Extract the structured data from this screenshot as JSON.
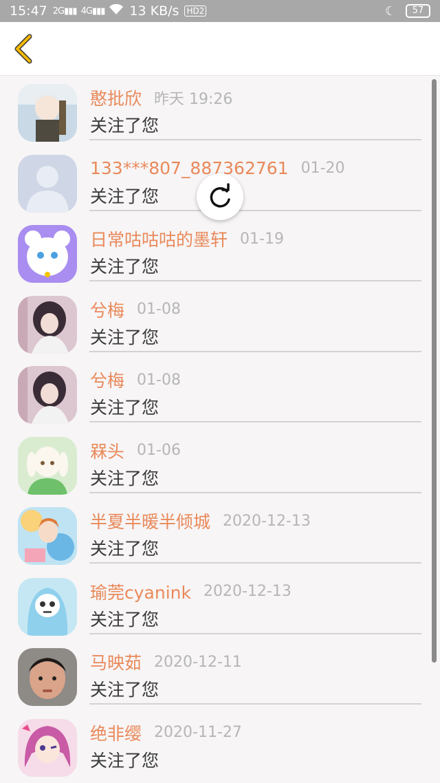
{
  "status_bar": {
    "time": "15:47",
    "signal1": "2G",
    "signal2": "4G",
    "speed": "13 KB/s",
    "hd": "HD2",
    "battery": "57"
  },
  "header": {
    "back_icon": "chevron-left-icon",
    "accent": "#f5b800"
  },
  "list": {
    "items": [
      {
        "name": "憨批欣",
        "date": "昨天 19:26",
        "action": "关注了您",
        "avatar": "anime-boy-avatar"
      },
      {
        "name": "133***807_887362761",
        "date": "01-20",
        "action": "关注了您",
        "avatar": "default-person-avatar"
      },
      {
        "name": "日常咕咕咕的墨轩",
        "date": "01-19",
        "action": "关注了您",
        "avatar": "anime-white-cat-avatar"
      },
      {
        "name": "兮梅",
        "date": "01-08",
        "action": "关注了您",
        "avatar": "anime-girl-avatar"
      },
      {
        "name": "兮梅",
        "date": "01-08",
        "action": "关注了您",
        "avatar": "anime-girl-avatar"
      },
      {
        "name": "槑头",
        "date": "01-06",
        "action": "关注了您",
        "avatar": "goat-character-avatar"
      },
      {
        "name": "半夏半暖半倾城",
        "date": "2020-12-13",
        "action": "关注了您",
        "avatar": "colorful-anime-avatar"
      },
      {
        "name": "瑜莞cyanink",
        "date": "2020-12-13",
        "action": "关注了您",
        "avatar": "skeleton-hoodie-avatar"
      },
      {
        "name": "马映茹",
        "date": "2020-12-11",
        "action": "关注了您",
        "avatar": "child-photo-avatar"
      },
      {
        "name": "绝非缨",
        "date": "2020-11-27",
        "action": "关注了您",
        "avatar": "pink-hair-anime-avatar"
      }
    ]
  },
  "colors": {
    "name": "#e9895a",
    "date": "#b6b6b6",
    "action": "#3a3a3a"
  },
  "refresh_icon": "refresh-icon"
}
